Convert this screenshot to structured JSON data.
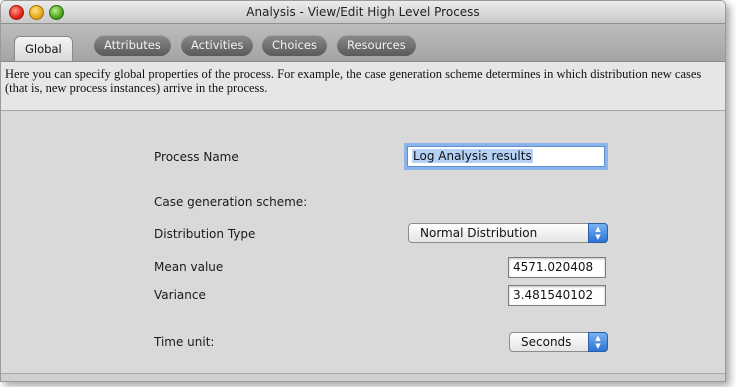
{
  "window": {
    "title": "Analysis - View/Edit High Level Process"
  },
  "tabs": [
    {
      "label": "Global",
      "active": true
    },
    {
      "label": "Attributes",
      "active": false
    },
    {
      "label": "Activities",
      "active": false
    },
    {
      "label": "Choices",
      "active": false
    },
    {
      "label": "Resources",
      "active": false
    }
  ],
  "description": "Here you can specify global properties of the process. For example, the case generation scheme determines in which distribution new cases (that is, new process instances) arrive in the process.",
  "form": {
    "process_name_label": "Process Name",
    "process_name_value": "Log Analysis results",
    "case_generation_label": "Case generation scheme:",
    "distribution_type_label": "Distribution Type",
    "distribution_type_value": "Normal Distribution",
    "mean_label": "Mean value",
    "mean_value": "4571.020408",
    "variance_label": "Variance",
    "variance_value": "3.481540102",
    "time_unit_label": "Time unit:",
    "time_unit_value": "Seconds"
  },
  "colors": {
    "accent": "#2b73d6",
    "focus_ring": "#8bb4ea",
    "selection": "#b5d1f5"
  }
}
